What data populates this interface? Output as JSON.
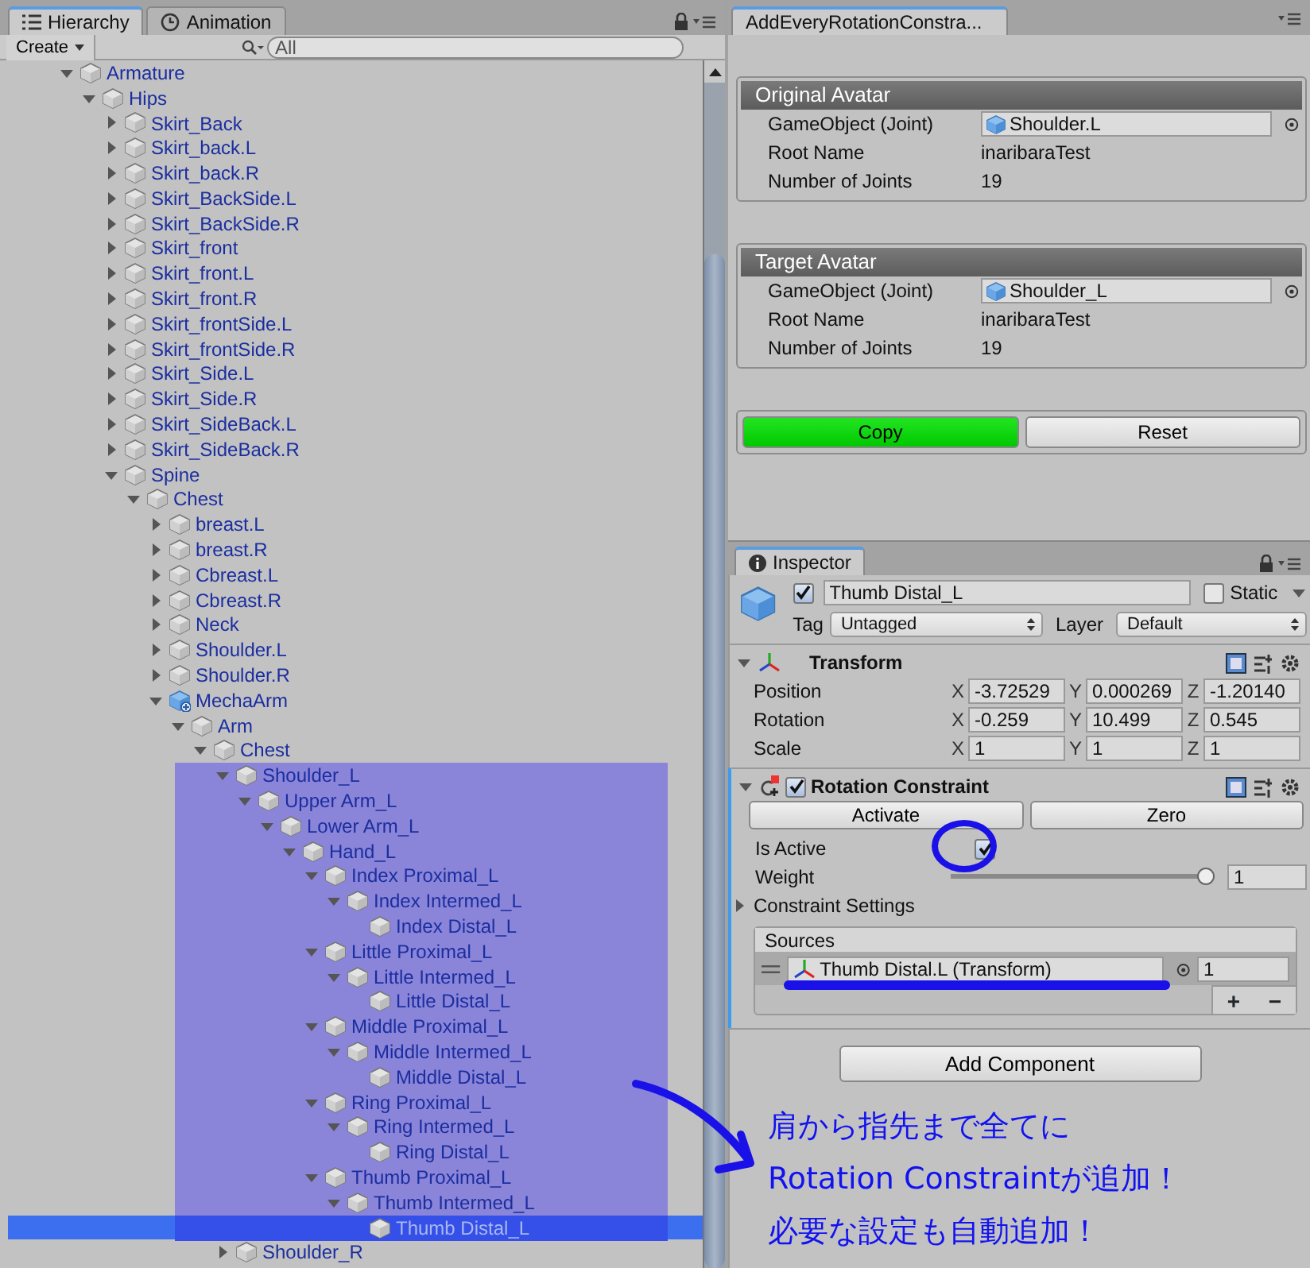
{
  "hierarchy": {
    "tabs": [
      {
        "label": "Hierarchy",
        "kind": "list",
        "selected": true
      },
      {
        "label": "Animation",
        "kind": "clock",
        "selected": false
      }
    ],
    "create_button": "Create",
    "search": {
      "placeholder": "All"
    },
    "tree": [
      {
        "name": "Armature",
        "kind": "object",
        "expanded": true,
        "selected": false,
        "highlighted": false,
        "children": [
          {
            "name": "Hips",
            "kind": "object",
            "expanded": true,
            "selected": false,
            "highlighted": false,
            "children": [
              {
                "name": "Skirt_Back",
                "kind": "object",
                "expanded": false,
                "selected": false,
                "highlighted": false
              },
              {
                "name": "Skirt_back.L",
                "kind": "object",
                "expanded": false,
                "selected": false,
                "highlighted": false
              },
              {
                "name": "Skirt_back.R",
                "kind": "object",
                "expanded": false,
                "selected": false,
                "highlighted": false
              },
              {
                "name": "Skirt_BackSide.L",
                "kind": "object",
                "expanded": false,
                "selected": false,
                "highlighted": false
              },
              {
                "name": "Skirt_BackSide.R",
                "kind": "object",
                "expanded": false,
                "selected": false,
                "highlighted": false
              },
              {
                "name": "Skirt_front",
                "kind": "object",
                "expanded": false,
                "selected": false,
                "highlighted": false
              },
              {
                "name": "Skirt_front.L",
                "kind": "object",
                "expanded": false,
                "selected": false,
                "highlighted": false
              },
              {
                "name": "Skirt_front.R",
                "kind": "object",
                "expanded": false,
                "selected": false,
                "highlighted": false
              },
              {
                "name": "Skirt_frontSide.L",
                "kind": "object",
                "expanded": false,
                "selected": false,
                "highlighted": false
              },
              {
                "name": "Skirt_frontSide.R",
                "kind": "object",
                "expanded": false,
                "selected": false,
                "highlighted": false
              },
              {
                "name": "Skirt_Side.L",
                "kind": "object",
                "expanded": false,
                "selected": false,
                "highlighted": false
              },
              {
                "name": "Skirt_Side.R",
                "kind": "object",
                "expanded": false,
                "selected": false,
                "highlighted": false
              },
              {
                "name": "Skirt_SideBack.L",
                "kind": "object",
                "expanded": false,
                "selected": false,
                "highlighted": false
              },
              {
                "name": "Skirt_SideBack.R",
                "kind": "object",
                "expanded": false,
                "selected": false,
                "highlighted": false
              },
              {
                "name": "Spine",
                "kind": "object",
                "expanded": true,
                "selected": false,
                "highlighted": false,
                "children": [
                  {
                    "name": "Chest",
                    "kind": "object",
                    "expanded": true,
                    "selected": false,
                    "highlighted": false,
                    "children": [
                      {
                        "name": "breast.L",
                        "kind": "object",
                        "expanded": false,
                        "selected": false,
                        "highlighted": false
                      },
                      {
                        "name": "breast.R",
                        "kind": "object",
                        "expanded": false,
                        "selected": false,
                        "highlighted": false
                      },
                      {
                        "name": "Cbreast.L",
                        "kind": "object",
                        "expanded": false,
                        "selected": false,
                        "highlighted": false
                      },
                      {
                        "name": "Cbreast.R",
                        "kind": "object",
                        "expanded": false,
                        "selected": false,
                        "highlighted": false
                      },
                      {
                        "name": "Neck",
                        "kind": "object",
                        "expanded": false,
                        "selected": false,
                        "highlighted": false
                      },
                      {
                        "name": "Shoulder.L",
                        "kind": "object",
                        "expanded": false,
                        "selected": false,
                        "highlighted": false
                      },
                      {
                        "name": "Shoulder.R",
                        "kind": "object",
                        "expanded": false,
                        "selected": false,
                        "highlighted": false
                      },
                      {
                        "name": "MechaArm",
                        "kind": "prefab",
                        "expanded": true,
                        "selected": false,
                        "highlighted": false,
                        "children": [
                          {
                            "name": "Arm",
                            "kind": "object",
                            "expanded": true,
                            "selected": false,
                            "highlighted": false,
                            "children": [
                              {
                                "name": "Chest",
                                "kind": "object",
                                "expanded": true,
                                "selected": false,
                                "highlighted": false,
                                "children": [
                                  {
                                    "name": "Shoulder_L",
                                    "kind": "object",
                                    "expanded": true,
                                    "selected": false,
                                    "highlighted": true,
                                    "children": [
                                      {
                                        "name": "Upper Arm_L",
                                        "kind": "object",
                                        "expanded": true,
                                        "selected": false,
                                        "highlighted": true,
                                        "children": [
                                          {
                                            "name": "Lower Arm_L",
                                            "kind": "object",
                                            "expanded": true,
                                            "selected": false,
                                            "highlighted": true,
                                            "children": [
                                              {
                                                "name": "Hand_L",
                                                "kind": "object",
                                                "expanded": true,
                                                "selected": false,
                                                "highlighted": true,
                                                "children": [
                                                  {
                                                    "name": "Index Proximal_L",
                                                    "kind": "object",
                                                    "expanded": true,
                                                    "selected": false,
                                                    "highlighted": true,
                                                    "children": [
                                                      {
                                                        "name": "Index Intermed_L",
                                                        "kind": "object",
                                                        "expanded": true,
                                                        "selected": false,
                                                        "highlighted": true,
                                                        "children": [
                                                          {
                                                            "name": "Index Distal_L",
                                                            "kind": "object",
                                                            "selected": false,
                                                            "highlighted": true
                                                          }
                                                        ]
                                                      }
                                                    ]
                                                  },
                                                  {
                                                    "name": "Little Proximal_L",
                                                    "kind": "object",
                                                    "expanded": true,
                                                    "selected": false,
                                                    "highlighted": true,
                                                    "children": [
                                                      {
                                                        "name": "Little Intermed_L",
                                                        "kind": "object",
                                                        "expanded": true,
                                                        "selected": false,
                                                        "highlighted": true,
                                                        "children": [
                                                          {
                                                            "name": "Little Distal_L",
                                                            "kind": "object",
                                                            "selected": false,
                                                            "highlighted": true
                                                          }
                                                        ]
                                                      }
                                                    ]
                                                  },
                                                  {
                                                    "name": "Middle Proximal_L",
                                                    "kind": "object",
                                                    "expanded": true,
                                                    "selected": false,
                                                    "highlighted": true,
                                                    "children": [
                                                      {
                                                        "name": "Middle Intermed_L",
                                                        "kind": "object",
                                                        "expanded": true,
                                                        "selected": false,
                                                        "highlighted": true,
                                                        "children": [
                                                          {
                                                            "name": "Middle Distal_L",
                                                            "kind": "object",
                                                            "selected": false,
                                                            "highlighted": true
                                                          }
                                                        ]
                                                      }
                                                    ]
                                                  },
                                                  {
                                                    "name": "Ring Proximal_L",
                                                    "kind": "object",
                                                    "expanded": true,
                                                    "selected": false,
                                                    "highlighted": true,
                                                    "children": [
                                                      {
                                                        "name": "Ring Intermed_L",
                                                        "kind": "object",
                                                        "expanded": true,
                                                        "selected": false,
                                                        "highlighted": true,
                                                        "children": [
                                                          {
                                                            "name": "Ring Distal_L",
                                                            "kind": "object",
                                                            "selected": false,
                                                            "highlighted": true
                                                          }
                                                        ]
                                                      }
                                                    ]
                                                  },
                                                  {
                                                    "name": "Thumb Proximal_L",
                                                    "kind": "object",
                                                    "expanded": true,
                                                    "selected": false,
                                                    "highlighted": true,
                                                    "children": [
                                                      {
                                                        "name": "Thumb Intermed_L",
                                                        "kind": "object",
                                                        "expanded": true,
                                                        "selected": false,
                                                        "highlighted": true,
                                                        "children": [
                                                          {
                                                            "name": "Thumb Distal_L",
                                                            "kind": "object",
                                                            "selected": true,
                                                            "highlighted": true
                                                          }
                                                        ]
                                                      }
                                                    ]
                                                  }
                                                ]
                                              }
                                            ]
                                          }
                                        ]
                                      }
                                    ]
                                  },
                                  {
                                    "name": "Shoulder_R",
                                    "kind": "object",
                                    "expanded": false,
                                    "selected": false,
                                    "highlighted": false
                                  }
                                ]
                              }
                            ]
                          }
                        ]
                      }
                    ]
                  }
                ]
              }
            ]
          }
        ]
      }
    ]
  },
  "tool_window": {
    "tab": "AddEveryRotationConstra...",
    "sections": [
      {
        "title": "Original Avatar",
        "fields": [
          {
            "label": "GameObject (Joint)",
            "value": "Shoulder.L",
            "kind": "object"
          },
          {
            "label": "Root Name",
            "value": "inaribaraTest",
            "kind": "text"
          },
          {
            "label": "Number of Joints",
            "value": "19",
            "kind": "text"
          }
        ]
      },
      {
        "title": "Target Avatar",
        "fields": [
          {
            "label": "GameObject (Joint)",
            "value": "Shoulder_L",
            "kind": "object"
          },
          {
            "label": "Root Name",
            "value": "inaribaraTest",
            "kind": "text"
          },
          {
            "label": "Number of Joints",
            "value": "19",
            "kind": "text"
          }
        ]
      }
    ],
    "buttons": [
      {
        "label": "Copy",
        "kind": "primary"
      },
      {
        "label": "Reset",
        "kind": "normal"
      }
    ]
  },
  "inspector": {
    "tab": "Inspector",
    "object": {
      "active": true,
      "name": "Thumb Distal_L",
      "static": false,
      "static_label": "Static",
      "tag_label": "Tag",
      "tag": "Untagged",
      "layer_label": "Layer",
      "layer": "Default"
    },
    "components": [
      {
        "kind": "transform",
        "title": "Transform",
        "expanded": true,
        "rows": [
          {
            "label": "Position",
            "values": [
              {
                "axis": "X",
                "value": "-3.72529"
              },
              {
                "axis": "Y",
                "value": "0.000269"
              },
              {
                "axis": "Z",
                "value": "-1.20140"
              }
            ]
          },
          {
            "label": "Rotation",
            "values": [
              {
                "axis": "X",
                "value": "-0.259"
              },
              {
                "axis": "Y",
                "value": "10.499"
              },
              {
                "axis": "Z",
                "value": "0.545"
              }
            ]
          },
          {
            "label": "Scale",
            "values": [
              {
                "axis": "X",
                "value": "1"
              },
              {
                "axis": "Y",
                "value": "1"
              },
              {
                "axis": "Z",
                "value": "1"
              }
            ]
          }
        ]
      },
      {
        "kind": "constraint",
        "title": "Rotation Constraint",
        "expanded": true,
        "enabled": true,
        "buttons": [
          "Activate",
          "Zero"
        ],
        "is_active": {
          "label": "Is Active",
          "checked": true
        },
        "weight": {
          "label": "Weight",
          "level": 1,
          "value": "1"
        },
        "settings": {
          "label": "Constraint Settings",
          "expanded": false
        },
        "sources": {
          "title": "Sources",
          "items": [
            {
              "name": "Thumb Distal.L (Transform)",
              "weight": "1"
            }
          ],
          "add": "+",
          "remove": "−"
        }
      }
    ],
    "add_component": "Add Component"
  },
  "annotation": {
    "lines": [
      "肩から指先まで全てに",
      "Rotation Constraintが追加！",
      "必要な設定も自動追加！"
    ]
  }
}
